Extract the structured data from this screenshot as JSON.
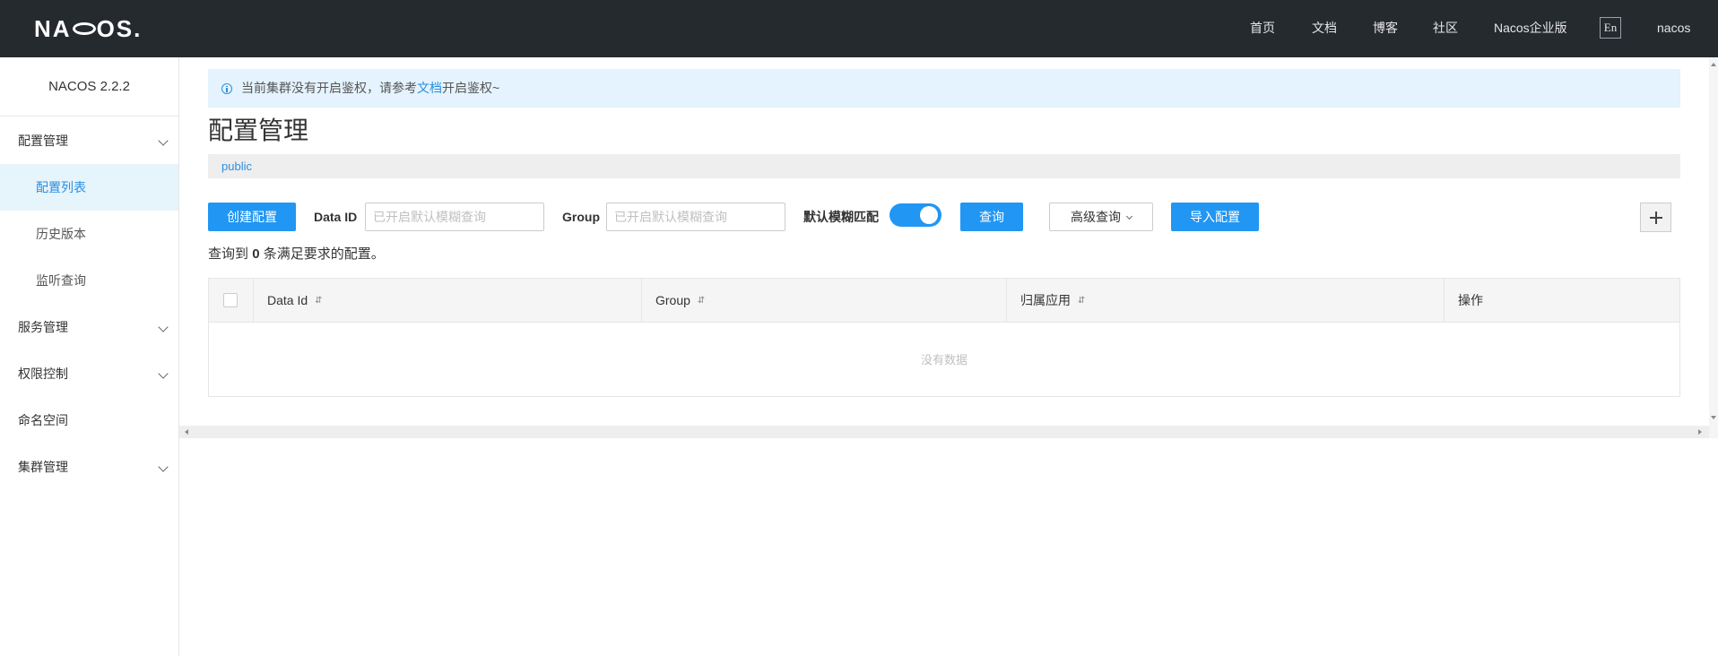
{
  "header": {
    "logo_text": "NACOS.",
    "nav": [
      "首页",
      "文档",
      "博客",
      "社区",
      "Nacos企业版"
    ],
    "lang": "En",
    "user": "nacos",
    "bg_color": "#252a2f"
  },
  "sidebar": {
    "version": "NACOS 2.2.2",
    "items": [
      {
        "label": "配置管理",
        "expandable": true
      },
      {
        "label": "配置列表",
        "active": true
      },
      {
        "label": "历史版本"
      },
      {
        "label": "监听查询"
      },
      {
        "label": "服务管理",
        "expandable": true
      },
      {
        "label": "权限控制",
        "expandable": true
      },
      {
        "label": "命名空间"
      },
      {
        "label": "集群管理",
        "expandable": true
      }
    ]
  },
  "alert": {
    "before": "当前集群没有开启鉴权，请参考",
    "link": "文档",
    "after": "开启鉴权~"
  },
  "page": {
    "title": "配置管理",
    "namespace": "public"
  },
  "toolbar": {
    "create_label": "创建配置",
    "dataid_label": "Data ID",
    "dataid_placeholder": "已开启默认模糊查询",
    "group_label": "Group",
    "group_placeholder": "已开启默认模糊查询",
    "fuzzy_label": "默认模糊匹配",
    "fuzzy_on": true,
    "query_label": "查询",
    "advanced_label": "高级查询",
    "import_label": "导入配置"
  },
  "result": {
    "prefix": "查询到",
    "count": "0",
    "suffix": "条满足要求的配置。"
  },
  "table": {
    "columns": [
      "Data Id",
      "Group",
      "归属应用",
      "操作"
    ],
    "sort_icon": "⇵",
    "empty_text": "没有数据"
  },
  "colors": {
    "primary": "#2196f3",
    "link": "#2a8ee0",
    "active_bg": "#e6f4fc"
  }
}
